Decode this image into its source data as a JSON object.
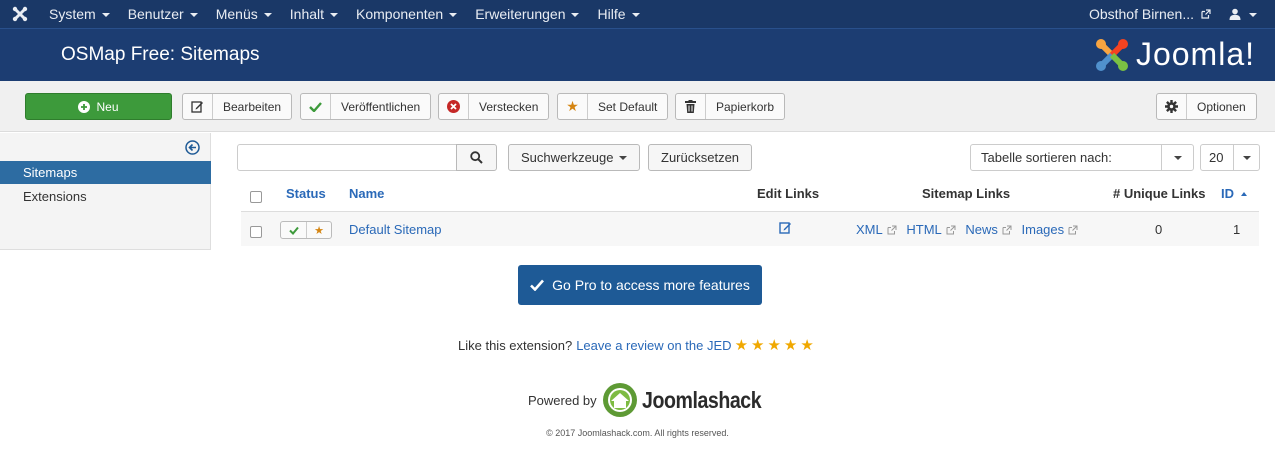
{
  "topnav": {
    "menu": [
      {
        "label": "System"
      },
      {
        "label": "Benutzer"
      },
      {
        "label": "Menüs"
      },
      {
        "label": "Inhalt"
      },
      {
        "label": "Komponenten"
      },
      {
        "label": "Erweiterungen"
      },
      {
        "label": "Hilfe"
      }
    ],
    "site_name": "Obsthof Birnen...",
    "user_icon": "user-icon"
  },
  "header": {
    "title": "OSMap Free: Sitemaps",
    "brand": "Joomla!"
  },
  "toolbar": {
    "new_label": "Neu",
    "edit_label": "Bearbeiten",
    "publish_label": "Veröffentlichen",
    "unpublish_label": "Verstecken",
    "default_label": "Set Default",
    "trash_label": "Papierkorb",
    "options_label": "Optionen"
  },
  "sidebar": {
    "items": [
      {
        "label": "Sitemaps",
        "active": true
      },
      {
        "label": "Extensions",
        "active": false
      }
    ]
  },
  "filters": {
    "search_placeholder": "",
    "search_tools_label": "Suchwerkzeuge",
    "reset_label": "Zurücksetzen",
    "sort_label": "Tabelle sortieren nach:",
    "limit_value": "20"
  },
  "table": {
    "headers": {
      "status": "Status",
      "name": "Name",
      "edit_links": "Edit Links",
      "sitemap_links": "Sitemap Links",
      "unique_links": "# Unique Links",
      "id": "ID"
    },
    "rows": [
      {
        "name": "Default Sitemap",
        "links": [
          "XML",
          "HTML",
          "News",
          "Images"
        ],
        "unique_links": "0",
        "id": "1"
      }
    ]
  },
  "promo": {
    "gopro_label": "Go Pro to access more features",
    "like_text": "Like this extension?",
    "review_link": "Leave a review on the JED",
    "rating": 5,
    "powered_by": "Powered by",
    "powered_brand": "Joomlashack",
    "copyright": "© 2017 Joomlashack.com. All rights reserved."
  },
  "colors": {
    "nav_bg": "#1a3867",
    "header_bg": "#1c3d72",
    "green": "#3d9a3b",
    "link": "#2a69b8",
    "gopro": "#1e5a96",
    "star": "#f0a800"
  }
}
